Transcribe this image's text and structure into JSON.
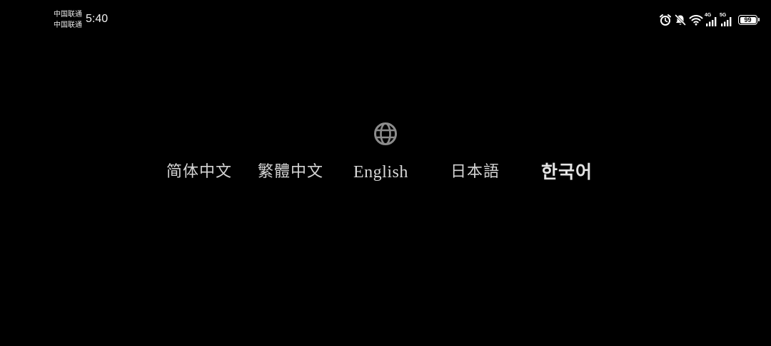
{
  "status_bar": {
    "carrier_1": "中国联通",
    "carrier_2": "中国联通",
    "time": "5:40",
    "icons": [
      "alarm-icon",
      "bell-muted-icon",
      "wifi-icon",
      "signal-icon",
      "signal-icon"
    ],
    "network_1": "4G",
    "network_2": "5G",
    "battery_level": "99",
    "color": "#ffffff"
  },
  "language_chooser": {
    "icon": "globe-icon",
    "icon_color": "#8c8c8c",
    "languages": [
      {
        "label": "简体中文"
      },
      {
        "label": "繁體中文"
      },
      {
        "label": "English"
      },
      {
        "label": "日本語"
      },
      {
        "label": "한국어"
      }
    ]
  },
  "background_color": "#000000"
}
